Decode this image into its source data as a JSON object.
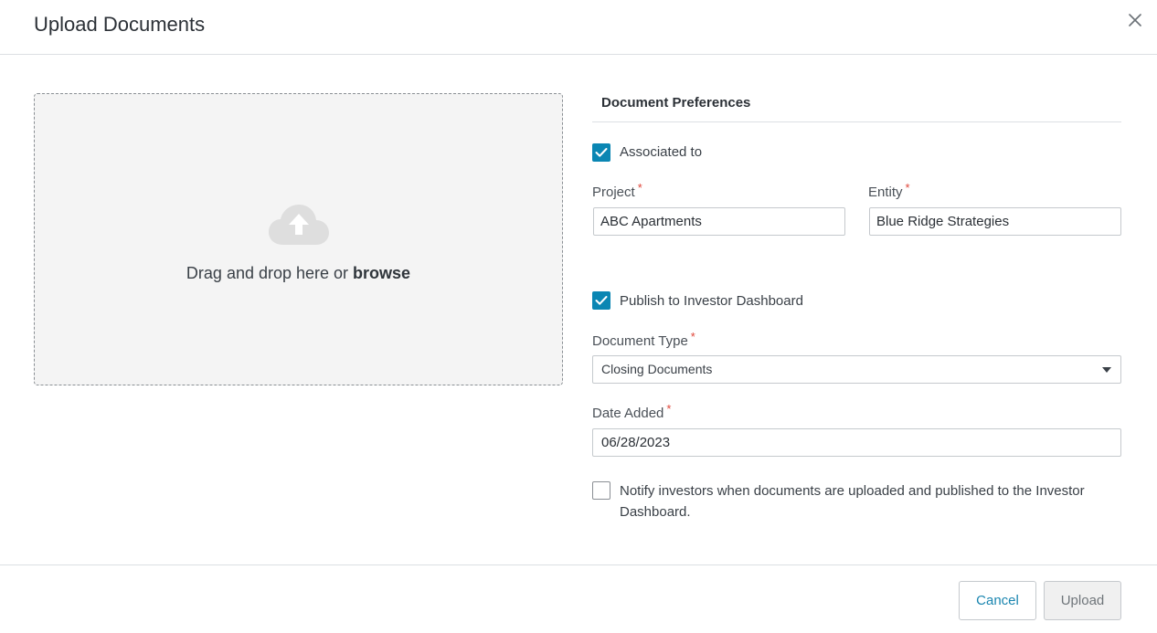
{
  "modal": {
    "title": "Upload Documents",
    "close_icon": "close-icon"
  },
  "dropzone": {
    "icon": "cloud-upload-icon",
    "text": "Drag and drop here or ",
    "browse_label": "browse"
  },
  "preferences": {
    "title": "Document Preferences",
    "associated_to": {
      "label": "Associated to",
      "checked": true
    },
    "project": {
      "label": "Project",
      "required_mark": "*",
      "value": "ABC Apartments"
    },
    "entity": {
      "label": "Entity",
      "required_mark": "*",
      "value": "Blue Ridge Strategies"
    },
    "publish_to_dashboard": {
      "label": "Publish to Investor Dashboard",
      "checked": true
    },
    "document_type": {
      "label": "Document Type",
      "required_mark": "*",
      "selected": "Closing Documents"
    },
    "date_added": {
      "label": "Date Added",
      "required_mark": "*",
      "value": "06/28/2023"
    },
    "notify_investors": {
      "label": "Notify investors when documents are uploaded and published to the Investor Dashboard.",
      "checked": false
    }
  },
  "footer": {
    "cancel_label": "Cancel",
    "upload_label": "Upload"
  },
  "colors": {
    "accent": "#0a86b3",
    "required": "#e0463a",
    "dropzone_bg": "#f4f4f4"
  }
}
